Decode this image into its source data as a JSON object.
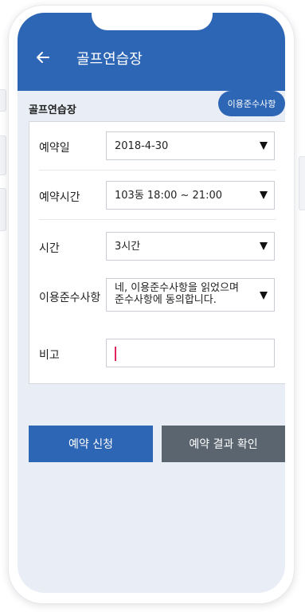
{
  "appbar": {
    "back_icon": "arrow-left-icon",
    "title": "골프연습장"
  },
  "info_button": {
    "label": "이용준수사항"
  },
  "section_title": "골프연습장",
  "form": {
    "reservation_date": {
      "label": "예약일",
      "value": "2018-4-30"
    },
    "reservation_time": {
      "label": "예약시간",
      "value": "103동 18:00 ~ 21:00"
    },
    "duration": {
      "label": "시간",
      "value": "3시간"
    },
    "terms": {
      "label": "이용준수사항",
      "value_line1": "네, 이용준수사항을 읽었으며",
      "value_line2": "준수사항에 동의합니다."
    },
    "note": {
      "label": "비고",
      "value": ""
    }
  },
  "buttons": {
    "apply": "예약 신청",
    "check": "예약 결과 확인"
  },
  "colors": {
    "primary": "#2e66b6",
    "secondary": "#5a6570",
    "screen_bg": "#e9eef6",
    "caret": "#e2245c"
  }
}
